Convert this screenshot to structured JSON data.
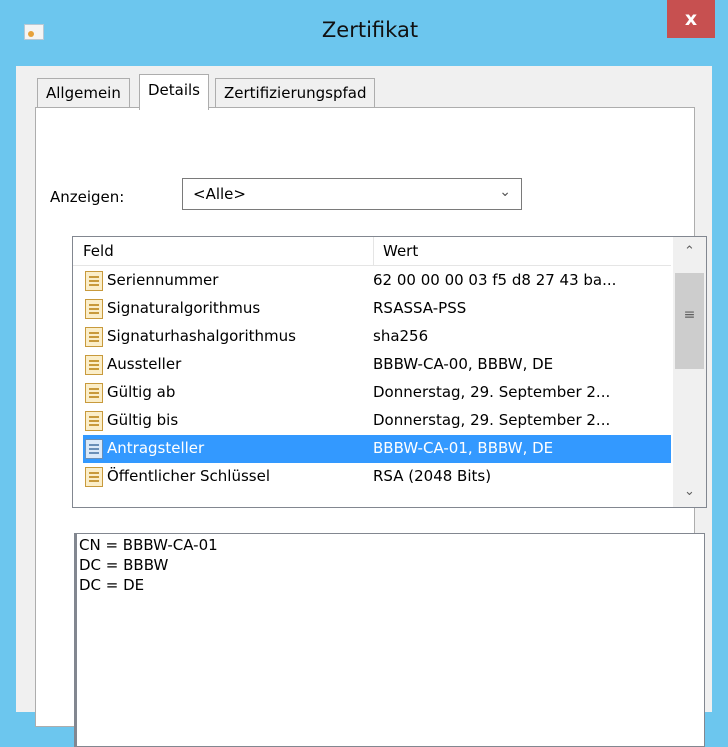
{
  "window": {
    "title": "Zertifikat",
    "close_label": "x"
  },
  "tabs": [
    {
      "label": "Allgemein"
    },
    {
      "label": "Details"
    },
    {
      "label": "Zertifizierungspfad"
    }
  ],
  "show": {
    "label": "Anzeigen:",
    "value": "<Alle>"
  },
  "list": {
    "columns": {
      "field": "Feld",
      "value": "Wert"
    },
    "rows": [
      {
        "field": "Seriennummer",
        "value": "62 00 00 00 03 f5 d8 27 43 ba..."
      },
      {
        "field": "Signaturalgorithmus",
        "value": "RSASSA-PSS"
      },
      {
        "field": "Signaturhashalgorithmus",
        "value": "sha256"
      },
      {
        "field": "Aussteller",
        "value": "BBBW-CA-00, BBBW, DE"
      },
      {
        "field": "Gültig ab",
        "value": "Donnerstag, 29. September 2..."
      },
      {
        "field": "Gültig bis",
        "value": "Donnerstag, 29. September 2..."
      },
      {
        "field": "Antragsteller",
        "value": "BBBW-CA-01, BBBW, DE"
      },
      {
        "field": "Öffentlicher Schlüssel",
        "value": "RSA (2048 Bits)"
      }
    ],
    "selected_index": 6
  },
  "detail": {
    "lines": [
      "CN = BBBW-CA-01",
      "DC = BBBW",
      "DC = DE"
    ]
  },
  "colors": {
    "titlebar": "#6cc6ee",
    "close": "#c75050",
    "selection": "#3399ff"
  }
}
